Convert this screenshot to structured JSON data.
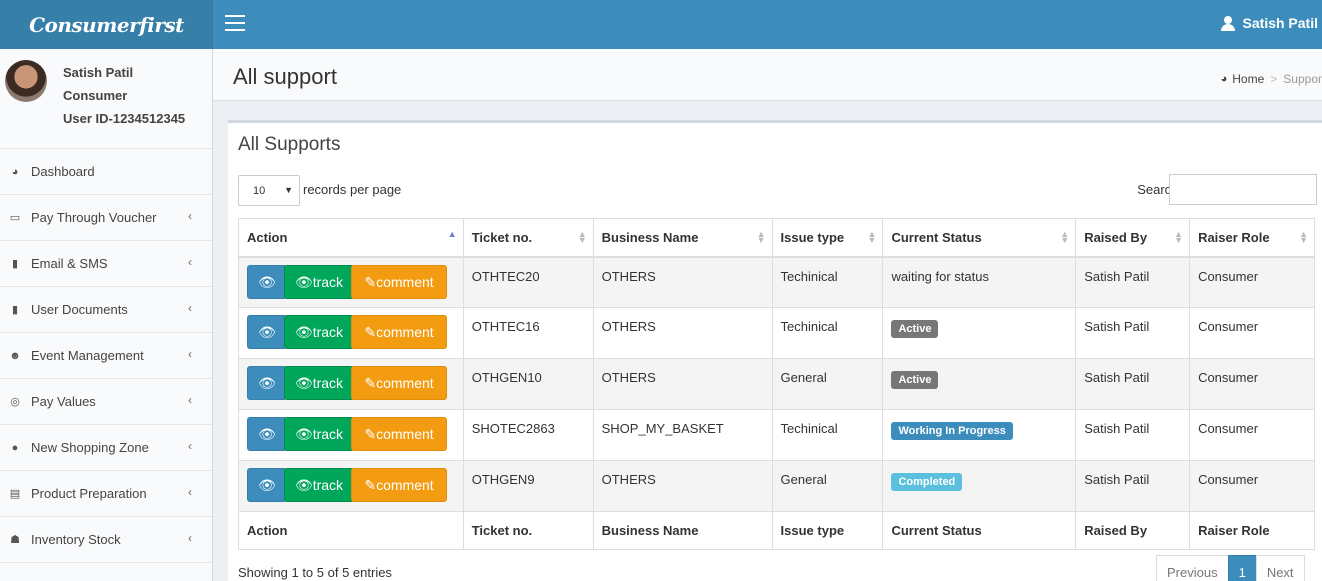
{
  "app": {
    "logo": "Consumerfirst"
  },
  "header": {
    "user_name": "Satish Patil"
  },
  "user_panel": {
    "name": "Satish Patil",
    "role": "Consumer",
    "user_id": "User ID-1234512345"
  },
  "sidebar": {
    "items": [
      {
        "label": "Dashboard",
        "icon": "dashboard-icon"
      },
      {
        "label": "Pay Through Voucher",
        "icon": "credit-card-icon"
      },
      {
        "label": "Email & SMS",
        "icon": "file-icon"
      },
      {
        "label": "User Documents",
        "icon": "file-icon"
      },
      {
        "label": "Event Management",
        "icon": "users-icon"
      },
      {
        "label": "Pay Values",
        "icon": "life-ring-icon"
      },
      {
        "label": "New Shopping Zone",
        "icon": "globe-icon"
      },
      {
        "label": "Product Preparation",
        "icon": "file-text-icon"
      },
      {
        "label": "Inventory Stock",
        "icon": "user-icon"
      }
    ]
  },
  "page": {
    "title": "All support"
  },
  "breadcrumb": {
    "home": "Home",
    "current": "Suppor"
  },
  "box": {
    "title": "All Supports",
    "length_value": "10",
    "length_label": "records per page",
    "search_label": "Search:"
  },
  "table": {
    "columns": [
      "Action",
      "Ticket no.",
      "Business Name",
      "Issue type",
      "Current Status",
      "Raised By",
      "Raiser Role"
    ],
    "buttons": {
      "track": "track",
      "comment": "comment"
    },
    "rows": [
      {
        "ticket": "OTHTEC20",
        "business": "OTHERS",
        "issue": "Techinical",
        "status": "waiting for status",
        "status_type": "text",
        "raised_by": "Satish Patil",
        "role": "Consumer"
      },
      {
        "ticket": "OTHTEC16",
        "business": "OTHERS",
        "issue": "Techinical",
        "status": "Active",
        "status_type": "gray",
        "raised_by": "Satish Patil",
        "role": "Consumer"
      },
      {
        "ticket": "OTHGEN10",
        "business": "OTHERS",
        "issue": "General",
        "status": "Active",
        "status_type": "gray",
        "raised_by": "Satish Patil",
        "role": "Consumer"
      },
      {
        "ticket": "SHOTEC2863",
        "business": "SHOP_MY_BASKET",
        "issue": "Techinical",
        "status": "Working In Progress",
        "status_type": "blue",
        "raised_by": "Satish Patil",
        "role": "Consumer"
      },
      {
        "ticket": "OTHGEN9",
        "business": "OTHERS",
        "issue": "General",
        "status": "Completed",
        "status_type": "aqua",
        "raised_by": "Satish Patil",
        "role": "Consumer"
      }
    ]
  },
  "status_colors": {
    "gray": "#777777",
    "blue": "#3c8dbc",
    "aqua": "#5bc0de"
  },
  "footer": {
    "info": "Showing 1 to 5 of 5 entries",
    "previous": "Previous",
    "page": "1",
    "next": "Next"
  }
}
